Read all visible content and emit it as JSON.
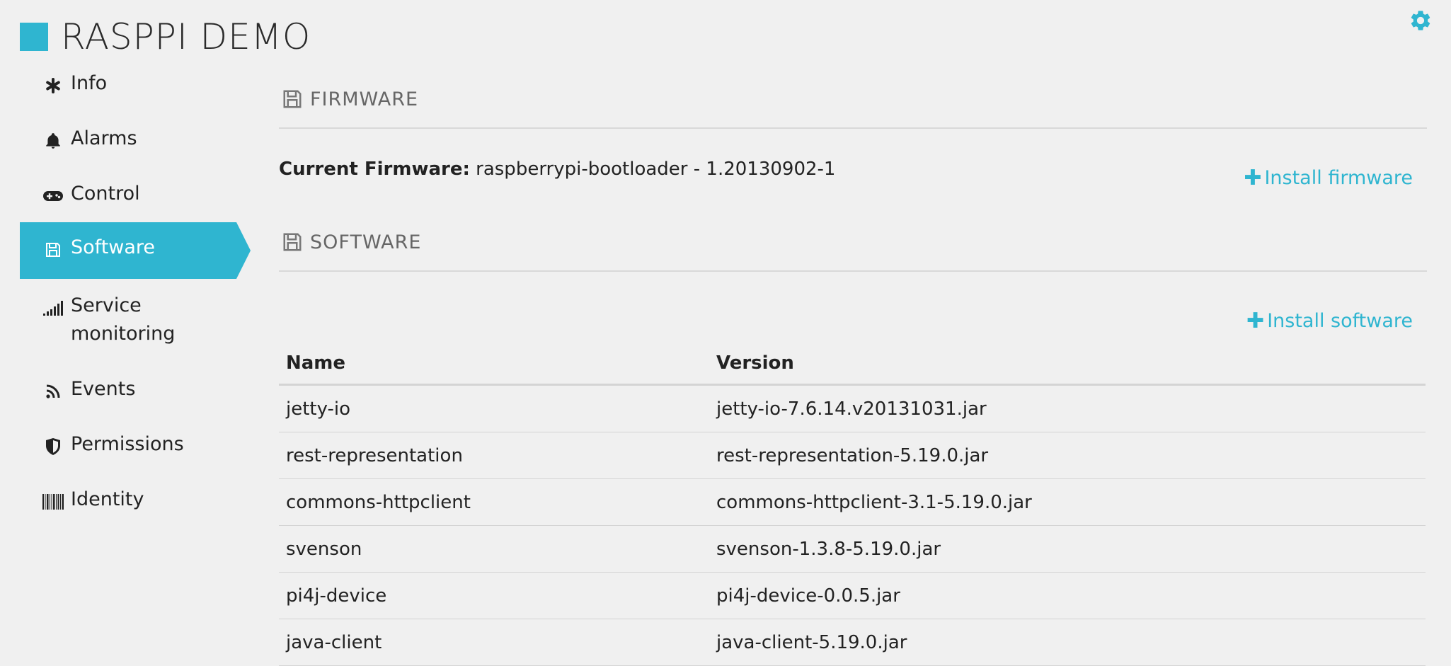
{
  "app": {
    "title": "RASPPI DEMO",
    "accent_color": "#2fb5d0",
    "settings_icon": "gear-icon"
  },
  "sidebar": {
    "items": [
      {
        "label": "Info",
        "icon": "asterisk-icon",
        "active": false
      },
      {
        "label": "Alarms",
        "icon": "bell-icon",
        "active": false
      },
      {
        "label": "Control",
        "icon": "gamepad-icon",
        "active": false
      },
      {
        "label": "Software",
        "icon": "floppy-disk-icon",
        "active": true
      },
      {
        "label": "Service monitoring",
        "icon": "signal-bars-icon",
        "active": false
      },
      {
        "label": "Events",
        "icon": "rss-icon",
        "active": false
      },
      {
        "label": "Permissions",
        "icon": "shield-icon",
        "active": false
      },
      {
        "label": "Identity",
        "icon": "barcode-icon",
        "active": false
      }
    ]
  },
  "firmware": {
    "section_title": "FIRMWARE",
    "current_label": "Current Firmware:",
    "current_value": "raspberrypi-bootloader - 1.20130902-1",
    "install_label": "Install firmware"
  },
  "software": {
    "section_title": "SOFTWARE",
    "install_label": "Install software",
    "columns": [
      "Name",
      "Version"
    ],
    "rows": [
      {
        "name": "jetty-io",
        "version": "jetty-io-7.6.14.v20131031.jar"
      },
      {
        "name": "rest-representation",
        "version": "rest-representation-5.19.0.jar"
      },
      {
        "name": "commons-httpclient",
        "version": "commons-httpclient-3.1-5.19.0.jar"
      },
      {
        "name": "svenson",
        "version": "svenson-1.3.8-5.19.0.jar"
      },
      {
        "name": "pi4j-device",
        "version": "pi4j-device-0.0.5.jar"
      },
      {
        "name": "java-client",
        "version": "java-client-5.19.0.jar"
      }
    ]
  }
}
